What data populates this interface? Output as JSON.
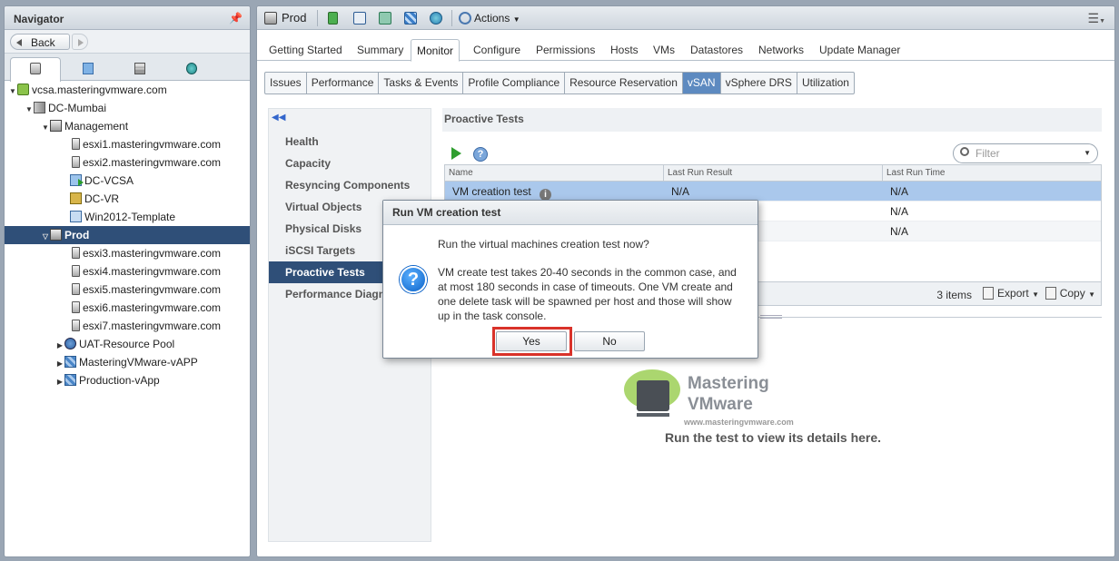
{
  "navigator": {
    "title": "Navigator",
    "back_label": "Back",
    "tree": [
      {
        "label": "vcsa.masteringvmware.com",
        "icon": "vcenter-icon"
      },
      {
        "label": "DC-Mumbai",
        "icon": "datacenter-icon"
      },
      {
        "label": "Management",
        "icon": "cluster-icon"
      },
      {
        "label": "esxi1.masteringvmware.com",
        "icon": "host-icon"
      },
      {
        "label": "esxi2.masteringvmware.com",
        "icon": "host-icon"
      },
      {
        "label": "DC-VCSA",
        "icon": "vm-powered-on-icon"
      },
      {
        "label": "DC-VR",
        "icon": "vr-appliance-icon"
      },
      {
        "label": "Win2012-Template",
        "icon": "template-icon"
      },
      {
        "label": "Prod",
        "icon": "cluster-icon"
      },
      {
        "label": "esxi3.masteringvmware.com",
        "icon": "host-icon"
      },
      {
        "label": "esxi4.masteringvmware.com",
        "icon": "host-icon"
      },
      {
        "label": "esxi5.masteringvmware.com",
        "icon": "host-icon"
      },
      {
        "label": "esxi6.masteringvmware.com",
        "icon": "host-icon"
      },
      {
        "label": "esxi7.masteringvmware.com",
        "icon": "host-icon"
      },
      {
        "label": "UAT-Resource Pool",
        "icon": "resource-pool-icon"
      },
      {
        "label": "MasteringVMware-vAPP",
        "icon": "vapp-icon"
      },
      {
        "label": "Production-vApp",
        "icon": "vapp-icon"
      }
    ]
  },
  "header": {
    "object_name": "Prod",
    "actions_label": "Actions"
  },
  "tabs": [
    "Getting Started",
    "Summary",
    "Monitor",
    "Configure",
    "Permissions",
    "Hosts",
    "VMs",
    "Datastores",
    "Networks",
    "Update Manager"
  ],
  "subtabs": [
    "Issues",
    "Performance",
    "Tasks & Events",
    "Profile Compliance",
    "Resource Reservation",
    "vSAN",
    "vSphere DRS",
    "Utilization"
  ],
  "side_menu": [
    "Health",
    "Capacity",
    "Resyncing Components",
    "Virtual Objects",
    "Physical Disks",
    "iSCSI Targets",
    "Proactive Tests",
    "Performance Diagnostics"
  ],
  "content": {
    "title": "Proactive Tests",
    "filter_placeholder": "Filter",
    "columns": [
      "Name",
      "Last Run Result",
      "Last Run Time"
    ],
    "rows": [
      [
        "VM creation test",
        "N/A",
        "N/A"
      ],
      [
        "",
        "",
        "N/A"
      ],
      [
        "",
        "",
        "N/A"
      ]
    ],
    "item_count": "3 items",
    "export_label": "Export",
    "copy_label": "Copy",
    "empty_hint": "Run the test to view its details here."
  },
  "watermark": {
    "line1": "Mastering",
    "line2": "VMware",
    "url": "www.masteringvmware.com"
  },
  "dialog": {
    "title": "Run VM creation test",
    "question": "Run the virtual machines creation test now?",
    "detail_lines": [
      "VM create test takes 20-40 seconds in the common case, and",
      "at most 180 seconds in case of timeouts. One VM create and",
      "one delete task will be spawned per host and those will show",
      "up in the task console."
    ],
    "yes_label": "Yes",
    "no_label": "No"
  },
  "colors": {
    "selection": "#2f4f78",
    "active_subtab": "#5d8ac0",
    "highlight_box": "#d9322a"
  }
}
